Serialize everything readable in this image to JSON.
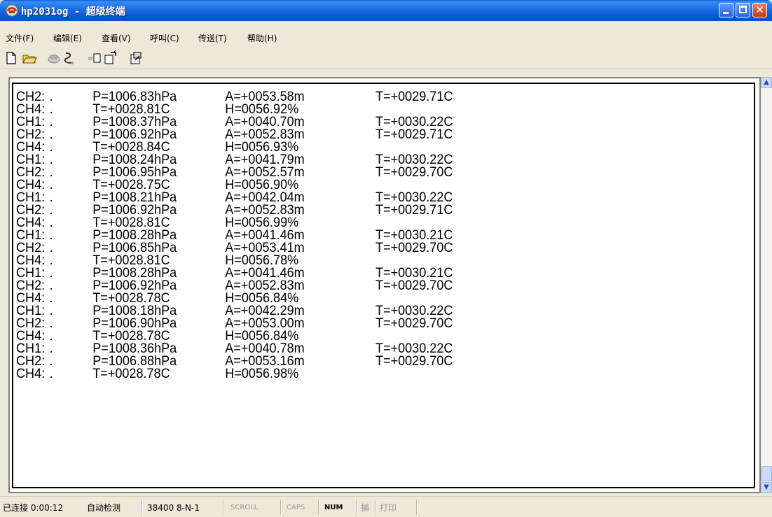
{
  "window": {
    "title": "hp2031og - 超级终端"
  },
  "menu": [
    {
      "label": "文件(F)"
    },
    {
      "label": "编辑(E)"
    },
    {
      "label": "查看(V)"
    },
    {
      "label": "呼叫(C)"
    },
    {
      "label": "传送(T)"
    },
    {
      "label": "帮助(H)"
    }
  ],
  "toolbar": {
    "icons": [
      "new-file-icon",
      "open-folder-icon",
      "connect-phone-icon",
      "disconnect-icon",
      "send-file-icon",
      "receive-file-icon",
      "properties-icon"
    ]
  },
  "terminal": {
    "lines": [
      [
        "CH2:",
        ".",
        "P=1006.83hPa",
        "A=+0053.58m",
        "T=+0029.71C"
      ],
      [
        "CH4:",
        ".",
        "T=+0028.81C",
        "H=0056.92%",
        ""
      ],
      [
        "CH1:",
        ".",
        "P=1008.37hPa",
        "A=+0040.70m",
        "T=+0030.22C"
      ],
      [
        "CH2:",
        ".",
        "P=1006.92hPa",
        "A=+0052.83m",
        "T=+0029.71C"
      ],
      [
        "CH4:",
        ".",
        "T=+0028.84C",
        "H=0056.93%",
        ""
      ],
      [
        "CH1:",
        ".",
        "P=1008.24hPa",
        "A=+0041.79m",
        "T=+0030.22C"
      ],
      [
        "CH2:",
        ".",
        "P=1006.95hPa",
        "A=+0052.57m",
        "T=+0029.70C"
      ],
      [
        "CH4:",
        ".",
        "T=+0028.75C",
        "H=0056.90%",
        ""
      ],
      [
        "CH1:",
        ".",
        "P=1008.21hPa",
        "A=+0042.04m",
        "T=+0030.22C"
      ],
      [
        "CH2:",
        ".",
        "P=1006.92hPa",
        "A=+0052.83m",
        "T=+0029.71C"
      ],
      [
        "CH4:",
        ".",
        "T=+0028.81C",
        "H=0056.99%",
        ""
      ],
      [
        "CH1:",
        ".",
        "P=1008.28hPa",
        "A=+0041.46m",
        "T=+0030.21C"
      ],
      [
        "CH2:",
        ".",
        "P=1006.85hPa",
        "A=+0053.41m",
        "T=+0029.70C"
      ],
      [
        "CH4:",
        ".",
        "T=+0028.81C",
        "H=0056.78%",
        ""
      ],
      [
        "CH1:",
        ".",
        "P=1008.28hPa",
        "A=+0041.46m",
        "T=+0030.21C"
      ],
      [
        "CH2:",
        ".",
        "P=1006.92hPa",
        "A=+0052.83m",
        "T=+0029.70C"
      ],
      [
        "CH4:",
        ".",
        "T=+0028.78C",
        "H=0056.84%",
        ""
      ],
      [
        "CH1:",
        ".",
        "P=1008.18hPa",
        "A=+0042.29m",
        "T=+0030.22C"
      ],
      [
        "CH2:",
        ".",
        "P=1006.90hPa",
        "A=+0053.00m",
        "T=+0029.70C"
      ],
      [
        "CH4:",
        ".",
        "T=+0028.78C",
        "H=0056.84%",
        ""
      ],
      [
        "CH1:",
        ".",
        "P=1008.36hPa",
        "A=+0040.78m",
        "T=+0030.22C"
      ],
      [
        "CH2:",
        ".",
        "P=1006.88hPa",
        "A=+0053.16m",
        "T=+0029.70C"
      ],
      [
        "CH4:",
        ".",
        "T=+0028.78C",
        "H=0056.98%",
        ""
      ]
    ]
  },
  "status": {
    "connection": "已连接 0:00:12",
    "detect": "自动检测",
    "settings": "38400 8-N-1",
    "scroll": "SCROLL",
    "caps": "CAPS",
    "num": "NUM",
    "capture": "捕",
    "print": "打印"
  }
}
